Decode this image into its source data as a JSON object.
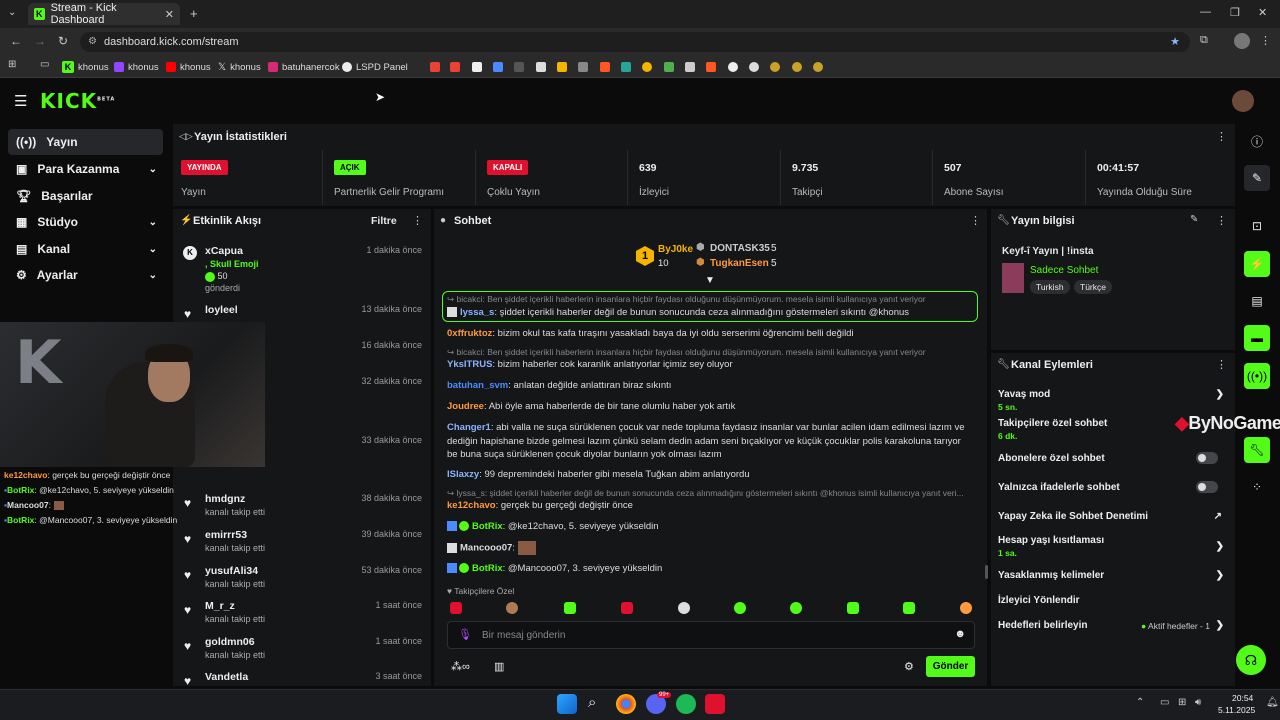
{
  "browser": {
    "tab_title": "Stream - Kick Dashboard",
    "url": "dashboard.kick.com/stream",
    "bookmarks": [
      "khonus",
      "khonus",
      "khonus",
      "khonus",
      "batuhanercok",
      "LSPD Panel"
    ]
  },
  "header": {
    "logo": "KICK",
    "logo_sup": "BETA"
  },
  "sidebar": {
    "items": [
      {
        "label": "Yayın",
        "icon": "broadcast-icon"
      },
      {
        "label": "Para Kazanma",
        "icon": "money-icon"
      },
      {
        "label": "Başarılar",
        "icon": "trophy-icon"
      },
      {
        "label": "Stüdyo",
        "icon": "studio-icon"
      },
      {
        "label": "Kanal",
        "icon": "channel-icon"
      },
      {
        "label": "Ayarlar",
        "icon": "gear-icon"
      }
    ]
  },
  "stats": {
    "title": "Yayın İstatistikleri",
    "cells": [
      {
        "badge": "YAYINDA",
        "label": "Yayın"
      },
      {
        "badge": "AÇIK",
        "label": "Partnerlik Gelir Programı"
      },
      {
        "badge": "KAPALI",
        "label": "Çoklu Yayın"
      },
      {
        "value": "639",
        "label": "İzleyici"
      },
      {
        "value": "9.735",
        "label": "Takipçi"
      },
      {
        "value": "507",
        "label": "Abone Sayısı"
      },
      {
        "value": "00:41:57",
        "label": "Yayında Olduğu Süre"
      }
    ]
  },
  "activity": {
    "title": "Etkinlik Akışı",
    "filter": "Filtre",
    "items": [
      {
        "name": "xCapua",
        "sub1": ", Skull Emoji",
        "sub2": "50",
        "sub3": "gönderdi",
        "time": "1 dakika önce"
      },
      {
        "name": "loyleel",
        "sub": "",
        "time": "13 dakika önce"
      },
      {
        "name": "",
        "sub": "",
        "time": "16 dakika önce"
      },
      {
        "name": "",
        "sub": "",
        "time": "32 dakika önce"
      },
      {
        "name": "",
        "sub": "",
        "time": "33 dakika önce"
      },
      {
        "name": "hmdgnz",
        "sub": "kanalı takip etti",
        "time": "38 dakika önce"
      },
      {
        "name": "emirrr53",
        "sub": "kanalı takip etti",
        "time": "39 dakika önce"
      },
      {
        "name": "yusufAli34",
        "sub": "kanalı takip etti",
        "time": "53 dakika önce"
      },
      {
        "name": "M_r_z",
        "sub": "kanalı takip etti",
        "time": "1 saat önce"
      },
      {
        "name": "goldmn06",
        "sub": "kanalı takip etti",
        "time": "1 saat önce"
      },
      {
        "name": "Vandetla",
        "sub": "",
        "time": "3 saat önce"
      }
    ]
  },
  "webcam_chat": [
    {
      "user": "ke12chavo",
      "text": ": gerçek bu gerçeği değiştir önce"
    },
    {
      "user": "BotRix",
      "text": ": @ke12chavo, 5. seviyeye yükseldin"
    },
    {
      "user": "Mancoo07",
      "text": ":"
    },
    {
      "user": "BotRix",
      "text": ": @Mancooo07, 3. seviyeye yükseldin"
    }
  ],
  "chat": {
    "title": "Sohbet",
    "top": [
      {
        "name": "ByJ0ke",
        "count": "10",
        "rank": "1"
      },
      {
        "name": "DONTASK35",
        "count": "5"
      },
      {
        "name": "TugkanEsen",
        "count": "5"
      }
    ],
    "messages": [
      {
        "reply": "bicakci: Ben şiddet içerikli haberlerin insanlara hiçbir faydası olduğunu düşünmüyorum. mesela isimli kullanıcıya yanıt veriyor",
        "user": "lyssa_s",
        "text": ": şiddet içerikli haberler değil de bunun sonucunda ceza alınmadığını göstermeleri sıkıntı @khonus",
        "color": "#8ab4ff"
      },
      {
        "user": "0xffruktoz",
        "text": ": bizim okul tas kafa tıraşını yasakladı baya da iyi oldu serserimi öğrencimi belli değildi",
        "color": "#ff9a3c"
      },
      {
        "reply": "bicakci: Ben şiddet içerikli haberlerin insanlara hiçbir faydası olduğunu düşünmüyorum. mesela isimli kullanıcıya yanıt veriyor",
        "user": "YksITRUS",
        "text": ": bizim haberler cok karanlık anlatıyorlar içimiz sey oluyor",
        "color": "#8ab4ff"
      },
      {
        "user": "batuhan_svm",
        "text": ": anlatan değilde anlattıran biraz sıkıntı",
        "color": "#4a8cff"
      },
      {
        "user": "Joudree",
        "text": ": Abi öyle ama haberlerde de bir tane olumlu haber yok artık",
        "color": "#ff9a3c"
      },
      {
        "user": "Changer1",
        "text": ": abi valla ne suça sürüklenen çocuk var nede topluma faydasız insanlar var bunlar acilen idam edilmesi lazım ve dediğin hapishane bizde gelmesi lazım çünkü selam dedin adam seni bıçaklıyor ve küçük çocuklar polis karakoluna tarıyor be buna suça sürüklenen çocuk diyolar bunların yok olması lazım",
        "color": "#8ab4ff"
      },
      {
        "user": "ISlaxzy",
        "text": ": 99 depremindeki haberler gibi mesela Tuğkan abim anlatıyordu",
        "color": "#8ab4ff"
      },
      {
        "reply": "lyssa_s: şiddet içerikli haberler değil de bunun sonucunda ceza alınmadığını göstermeleri sıkıntı @khonus isimli kullanıcıya yanıt veri...",
        "user": "ke12chavo",
        "text": ": gerçek bu gerçeği değiştir önce",
        "color": "#ff9a3c"
      },
      {
        "user": "BotRix",
        "text": ": @ke12chavo, 5. seviyeye yükseldin",
        "color": "#53fc18"
      },
      {
        "user": "Mancooo07",
        "text": ":",
        "color": "#eee"
      },
      {
        "user": "BotRix",
        "text": ": @Mancooo07, 3. seviyeye yükseldin",
        "color": "#53fc18"
      }
    ],
    "followers_only": "Takipçilere Özel",
    "placeholder": "Bir mesaj gönderin",
    "send": "Gönder"
  },
  "stream_info": {
    "title": "Yayın bilgisi",
    "stream_title": "Keyf-î Yayın | !insta",
    "category": "Sadece Sohbet",
    "tags": [
      "Turkish",
      "Türkçe"
    ]
  },
  "channel_actions": {
    "title": "Kanal Eylemleri",
    "items": [
      {
        "label": "Yavaş mod",
        "sub": "5 sn.",
        "control": "chevron"
      },
      {
        "label": "Takipçilere özel sohbet",
        "sub": "6 dk.",
        "control": "none"
      },
      {
        "label": "Abonelere özel sohbet",
        "control": "toggle"
      },
      {
        "label": "Yalnızca ifadelerle sohbet",
        "control": "toggle"
      },
      {
        "label": "Yapay Zeka ile Sohbet Denetimi",
        "control": "external"
      },
      {
        "label": "Hesap yaşı kısıtlaması",
        "sub": "1 sa.",
        "control": "chevron"
      },
      {
        "label": "Yasaklanmış kelimeler",
        "control": "chevron"
      },
      {
        "label": "İzleyici Yönlendir",
        "control": "none"
      },
      {
        "label": "Hedefleri belirleyin",
        "extra": "Aktif hedefler - 1",
        "control": "chevron"
      }
    ]
  },
  "watermark": "ByNoGame",
  "taskbar": {
    "time": "20:54",
    "date": "5.11.2025",
    "badge": "99+"
  },
  "colors": {
    "accent": "#53fc18",
    "live_red": "#e0102f",
    "panel": "#151618",
    "bg": "#0b0b0c"
  }
}
